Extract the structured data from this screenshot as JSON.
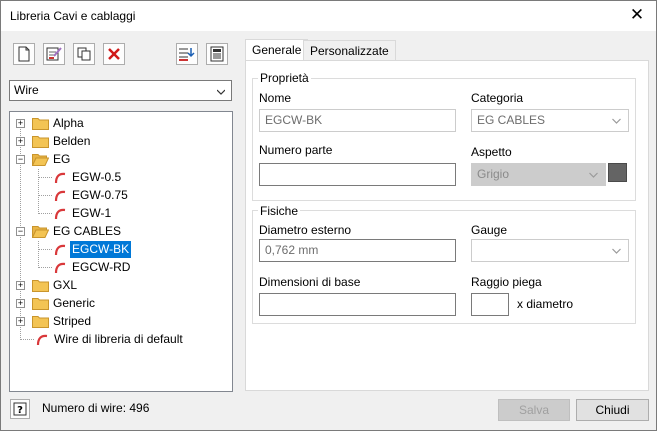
{
  "window": {
    "title": "Libreria Cavi e cablaggi"
  },
  "wire_type": {
    "selected": "Wire"
  },
  "tree": {
    "items": [
      {
        "label": "Alpha",
        "kind": "folder",
        "expander": "+"
      },
      {
        "label": "Belden",
        "kind": "folder",
        "expander": "+"
      },
      {
        "label": "EG",
        "kind": "folder",
        "expander": "−"
      },
      {
        "label": "EGW-0.5",
        "kind": "wire"
      },
      {
        "label": "EGW-0.75",
        "kind": "wire"
      },
      {
        "label": "EGW-1",
        "kind": "wire"
      },
      {
        "label": "EG CABLES",
        "kind": "folder",
        "expander": "−"
      },
      {
        "label": "EGCW-BK",
        "kind": "wire",
        "selected": true
      },
      {
        "label": "EGCW-RD",
        "kind": "wire"
      },
      {
        "label": "GXL",
        "kind": "folder",
        "expander": "+"
      },
      {
        "label": "Generic",
        "kind": "folder",
        "expander": "+"
      },
      {
        "label": "Striped",
        "kind": "folder",
        "expander": "+"
      },
      {
        "label": "Wire di libreria di default",
        "kind": "wire"
      }
    ]
  },
  "status": {
    "wire_count": "Numero di wire: 496"
  },
  "tabs": [
    {
      "label": "Generale",
      "active": true
    },
    {
      "label": "Personalizzate",
      "active": false
    }
  ],
  "properties": {
    "group_title": "Proprietà",
    "name_label": "Nome",
    "name_value": "EGCW-BK",
    "category_label": "Categoria",
    "category_value": "EG CABLES",
    "part_number_label": "Numero parte",
    "part_number_value": "",
    "appearance_label": "Aspetto",
    "appearance_value": "Grigio",
    "appearance_color": "#646464"
  },
  "physical": {
    "group_title": "Fisiche",
    "outer_diameter_label": "Diametro esterno",
    "outer_diameter_value": "0,762 mm",
    "gauge_label": "Gauge",
    "gauge_value": "",
    "base_dimensions_label": "Dimensioni di base",
    "base_dimensions_value": "",
    "bend_radius_label": "Raggio piega",
    "bend_radius_value": "",
    "bend_radius_unit": "x diametro"
  },
  "buttons": {
    "save": "Salva",
    "close": "Chiudi"
  },
  "colors": {
    "selection": "#0078d7",
    "folder": "#f3c454",
    "wire_icon": "#d9383a"
  }
}
